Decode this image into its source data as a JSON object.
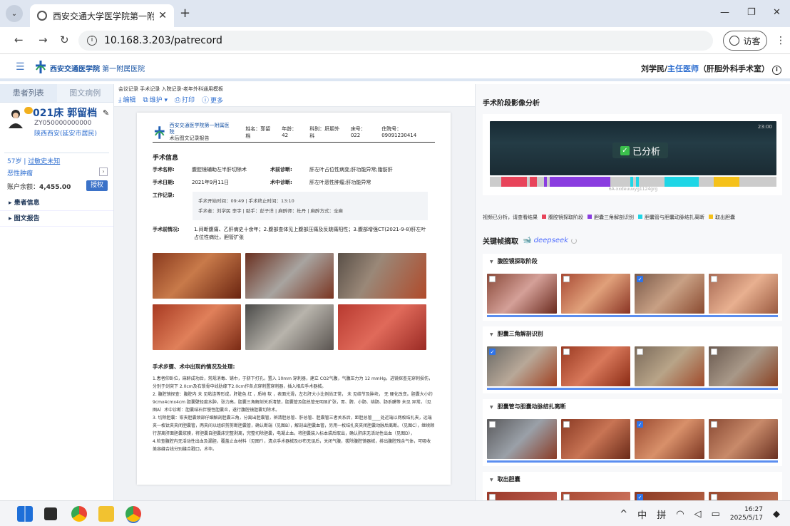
{
  "browser": {
    "tab_title": "西安交通大学医学院第一附属医",
    "url": "10.168.3.203/patrecord",
    "guest_label": "访客"
  },
  "header": {
    "org_name": "西安交通医学院",
    "org_sub": "第一附属医院",
    "user_name": "刘学民/",
    "user_role": "主任医师",
    "user_dept": "（肝胆外科手术室）"
  },
  "sidebar": {
    "tabs": [
      "患者列表",
      "图文病例"
    ],
    "bed_name": "021床 郭留档",
    "patient_id": "ZY050000000000",
    "address": "陕西西安(延安市居民)",
    "age": "57岁",
    "allergy": "过敏史未知",
    "diagnosis": "恶性肿瘤",
    "balance_label": "账户余额：",
    "balance_value": "4,455.00",
    "authorize_label": "授权",
    "sections": [
      "患者信息",
      "图文报告"
    ]
  },
  "document": {
    "breadcrumb": "会议记录  手术记录  入院记录-老年外科通用模板",
    "toolbar": [
      "编辑",
      "维护",
      "打印",
      "更多"
    ],
    "org_line1": "西安交通医学院第一附属医院",
    "org_line2": "术后图文记录报告",
    "meta": {
      "name": "姓名：郭留档",
      "age": "年龄：42",
      "dept": "科别：肝胆外科",
      "bed": "床号：022",
      "admission": "住院号：09091230414"
    },
    "section_title": "手术信息",
    "fields": {
      "op_name_label": "手术名称:",
      "op_name": "腹腔镜辅助左半肝切除术",
      "pre_diag_label": "术前诊断:",
      "pre_diag": "肝左叶占位性病变;肝功能异常;脂肪肝",
      "op_date_label": "手术日期:",
      "op_date": "2021年9月11日",
      "intra_diag_label": "术中诊断:",
      "intra_diag": "肝左叶恶性肿瘤;肝功能异常",
      "work_label": "工作记录:",
      "work_line1": "手术开始时间：09:49   |   手术终止时间：13:10",
      "work_line2": "手术者：刘学民 李宇   |   助手：彭子洋   |   麻醉师：杜丹   |   麻醉方式：全麻",
      "preop_label": "手术前情况:",
      "preop": "1.间断腹痛、乙肝病史十余年；2.腹部查体见上腹部压痛及反跳痛阳性；3.腹部增强CT(2021-9-8)肝左叶占位性病灶，胆管扩张"
    },
    "steps_title": "手术步骤、术中出现的情况及处理:",
    "steps": [
      "1.患者仰卧位，麻醉成功后，常规消毒、铺巾，于脐下打孔，置入 10mm 穿刺器，建立 CO2气腹，气腹压力为 12 mmHg。进镜探查无穿刺损伤，分别于剑突下 2.0cm及右锁骨中线肋缘下2.0cm作各点穿刺置穿刺器，插入相应手术器械。",
      "2. 腹腔镜探查：腹腔内 未 见粘连等形成，肝脏色 红 ，质地 软 ，表面光滑，左右肝大小比例尚正常， 未 见结节及肿块， 无 硬化改变。胆囊大小约9cmx4cmx4cm 胆囊壁轻度水肿，张力高，胆囊三角解剖关系清楚，胆囊管及胆总管无明显扩张，胃、脾、小肠、结肠、肠系膜等 未见 异常。（见图A）术中诊断：胆囊结石伴慢性胆囊炎，遂行腹腔镜胆囊切除术。",
      "3. 切除胆囊：钳夹胆囊颈部仔细解剖胆囊三角，分离出胆囊管，辨清胆总管、肝总管、胆囊管三者关系后，距胆总管____处近端以两枚结扎夹，远端夹一枚钛夹夹闭胆囊管，两夹间以组织剪剪断胆囊管，确认断端（见图B），解剖出胆囊血管，另用一枚结扎夹夹闭胆囊动脉后离断。（见图C），继续顺行游离肝面胆囊浆膜，将胆囊自胆囊床完整剥离，完整切除胆囊，电凝止血。将胆囊装入标本袋后取出，确认肝床无活动性出血（见图D），",
      "4.检查腹腔内无活动性出血及漏胆，覆盖止血材料（见图F），清点手术器械及纱布无误后，关闭气腹，拔除腹腔镜器械，排出腹腔残余气体，可吸收美容缝合线分别缝合戳口，术毕。"
    ]
  },
  "analysis": {
    "title": "手术阶段影像分析",
    "video_time": "23:00",
    "analyzed_label": "已分析",
    "video_id": "6A-xxdeuuvyg1124grg",
    "legend_prefix": "视频已分析，请查看结果",
    "legend": [
      {
        "label": "腹腔镜探取阶段",
        "color": "#e8445a"
      },
      {
        "label": "胆囊三角解剖识别",
        "color": "#8a3de0"
      },
      {
        "label": "胆囊管与胆囊动脉结扎离断",
        "color": "#1ed6e6"
      },
      {
        "label": "取出胆囊",
        "color": "#f5c11a"
      }
    ],
    "keyframe_title": "关键帧摘取",
    "ds_name": "deepseek",
    "stages": [
      "腹腔镜探取阶段",
      "胆囊三角解剖识别",
      "胆囊管与胆囊动脉结扎离断",
      "取出胆囊"
    ]
  },
  "taskbar": {
    "time": "16:27",
    "date": "2025/5/17",
    "ime1": "中",
    "ime2": "拼"
  }
}
